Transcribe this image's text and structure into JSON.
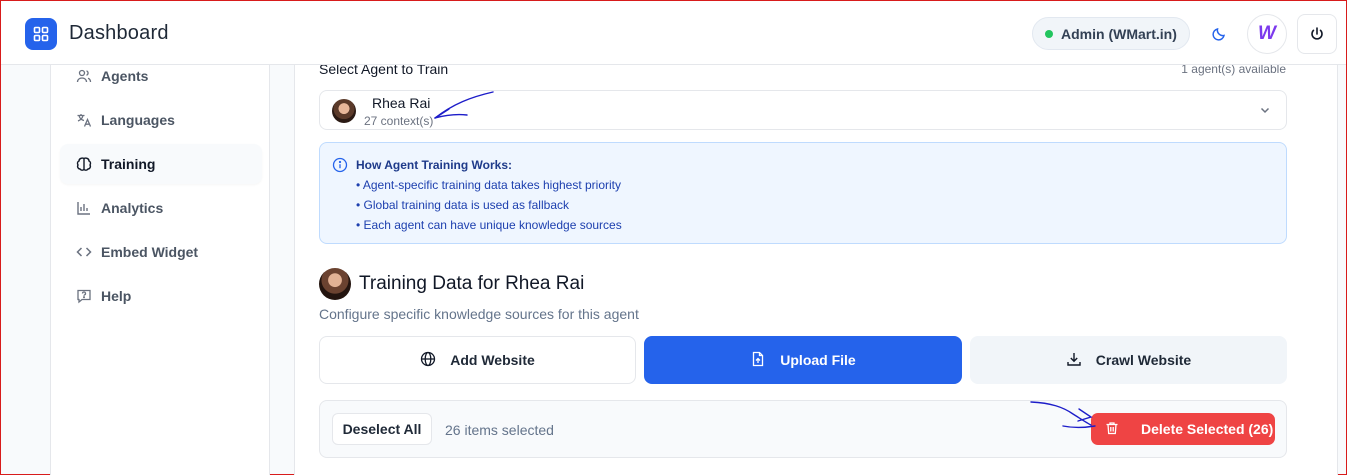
{
  "header": {
    "title": "Dashboard",
    "admin_label": "Admin (WMart.in)",
    "avatar_letter": "W",
    "status_color": "#22c55e",
    "accent_color": "#2563eb"
  },
  "sidebar": {
    "items": [
      {
        "label": "Agents",
        "icon": "users-icon",
        "active": false
      },
      {
        "label": "Languages",
        "icon": "translate-icon",
        "active": false
      },
      {
        "label": "Training",
        "icon": "brain-icon",
        "active": true
      },
      {
        "label": "Analytics",
        "icon": "bar-chart-icon",
        "active": false
      },
      {
        "label": "Embed Widget",
        "icon": "code-icon",
        "active": false
      },
      {
        "label": "Help",
        "icon": "help-chat-icon",
        "active": false
      }
    ]
  },
  "agent_select": {
    "label": "Select Agent to Train",
    "available": "1 agent(s) available",
    "selected_name": "Rhea Rai",
    "selected_contexts": "27 context(s)"
  },
  "info": {
    "title": "How Agent Training Works:",
    "lines": [
      "• Agent-specific training data takes highest priority",
      "• Global training data is used as fallback",
      "• Each agent can have unique knowledge sources"
    ]
  },
  "training": {
    "title": "Training Data for Rhea Rai",
    "subtitle": "Configure specific knowledge sources for this agent",
    "buttons": {
      "add_website": "Add Website",
      "upload_file": "Upload File",
      "crawl_website": "Crawl Website"
    }
  },
  "selection": {
    "deselect_label": "Deselect All",
    "count_text": "26 items selected",
    "delete_label": "Delete Selected (26)",
    "delete_color": "#ef4444"
  }
}
